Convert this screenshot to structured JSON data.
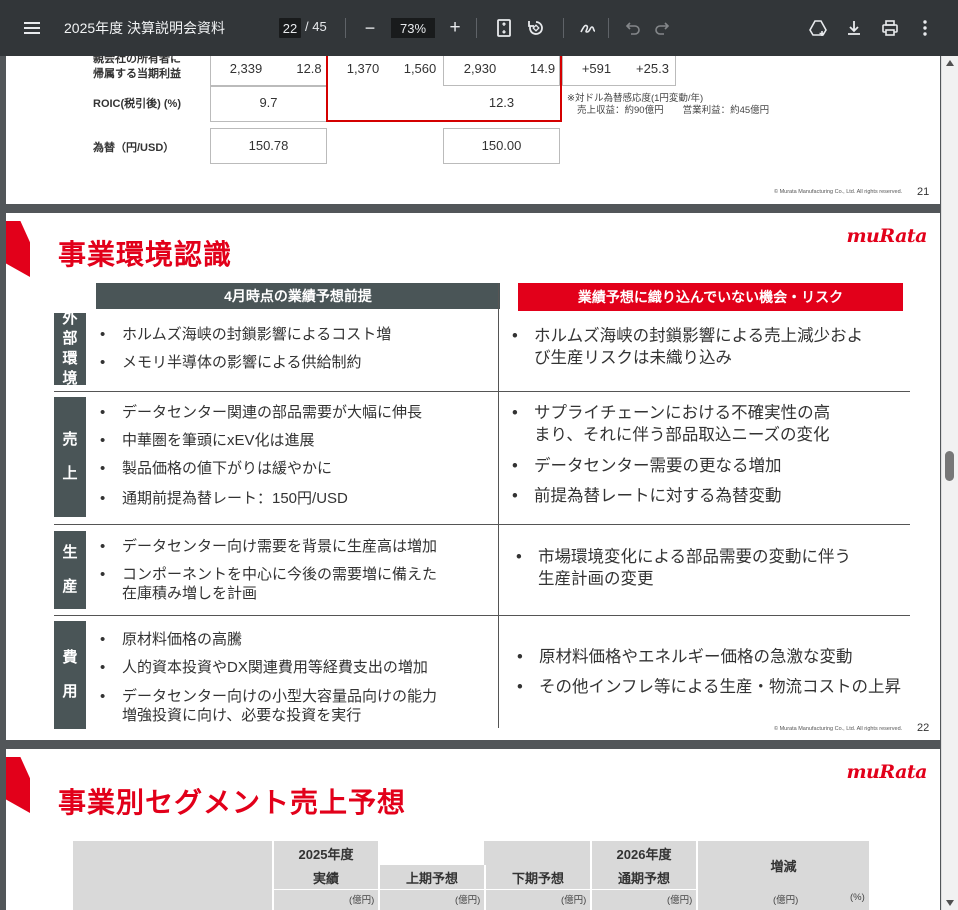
{
  "toolbar": {
    "title": "2025年度 決算説明会資料",
    "current_page": "22",
    "total_pages": "/ 45",
    "zoom": "73%",
    "minus": "−",
    "plus": "+"
  },
  "page21": {
    "row1_label": [
      "親会社の所有者に",
      "帰属する当期利益"
    ],
    "row1_values": [
      "2,339",
      "12.8",
      "1,370",
      "1,560",
      "2,930",
      "14.9",
      "+591",
      "+25.3"
    ],
    "row2_label": "ROIC(税引後) (%)",
    "row2_values": [
      "9.7",
      "12.3"
    ],
    "row3_label": "為替（円/USD）",
    "row3_values": [
      "150.78",
      "150.00"
    ],
    "note_line1": "※対ドル為替感応度(1円変動/年)",
    "note_line2": "売上収益：約90億円　　営業利益：約45億円",
    "footer": "© Murata Manufacturing Co., Ltd. All rights reserved.",
    "page_number": "21"
  },
  "page22": {
    "title": "事業環境認識",
    "logo": "muRata",
    "header_left": "4月時点の業績予想前提",
    "header_right": "業績予想に織り込んでいない機会・リスク",
    "rows": [
      {
        "label": [
          "外",
          "部",
          "環",
          "境"
        ],
        "left": [
          "ホルムズ海峡の封鎖影響によるコスト増",
          "メモリ半導体の影響による供給制約"
        ],
        "right": [
          "ホルムズ海峡の封鎖影響による売上減少およ\nび生産リスクは未織り込み"
        ]
      },
      {
        "label": [
          "売",
          "上"
        ],
        "left": [
          "データセンター関連の部品需要が大幅に伸長",
          "中華圏を筆頭にxEV化は進展",
          "製品価格の値下がりは緩やかに",
          "通期前提為替レート：150円/USD"
        ],
        "right": [
          "サプライチェーンにおける不確実性の高\nまり、それに伴う部品取込ニーズの変化",
          "データセンター需要の更なる増加",
          "前提為替レートに対する為替変動"
        ]
      },
      {
        "label": [
          "生",
          "産"
        ],
        "left": [
          "データセンター向け需要を背景に生産高は増加",
          "コンポーネントを中心に今後の需要増に備えた\n在庫積み増しを計画"
        ],
        "right": [
          "市場環境変化による部品需要の変動に伴う\n生産計画の変更"
        ]
      },
      {
        "label": [
          "費",
          "用"
        ],
        "left": [
          "原材料価格の高騰",
          "人的資本投資やDX関連費用等経費支出の増加",
          "データセンター向けの小型大容量品向けの能力\n増強投資に向け、必要な投資を実行"
        ],
        "right": [
          "原材料価格やエネルギー価格の急激な変動",
          "その他インフレ等による生産・物流コストの上昇"
        ]
      }
    ],
    "footer": "© Murata Manufacturing Co., Ltd. All rights reserved.",
    "page_number": "22"
  },
  "page23": {
    "title": "事業別セグメント売上予想",
    "logo": "muRata",
    "col_2025": "2025年度",
    "col_2025_sub": "実績",
    "col_2026": "2026年度",
    "col_h1": "上期予想",
    "col_h2": "下期予想",
    "col_full": "通期予想",
    "col_change": "増減",
    "unit": "(億円)",
    "unit_pct": "(%)"
  },
  "colors": {
    "brand_red": "#e2001a",
    "header_gray": "#4a5557",
    "toolbar": "#323639"
  }
}
